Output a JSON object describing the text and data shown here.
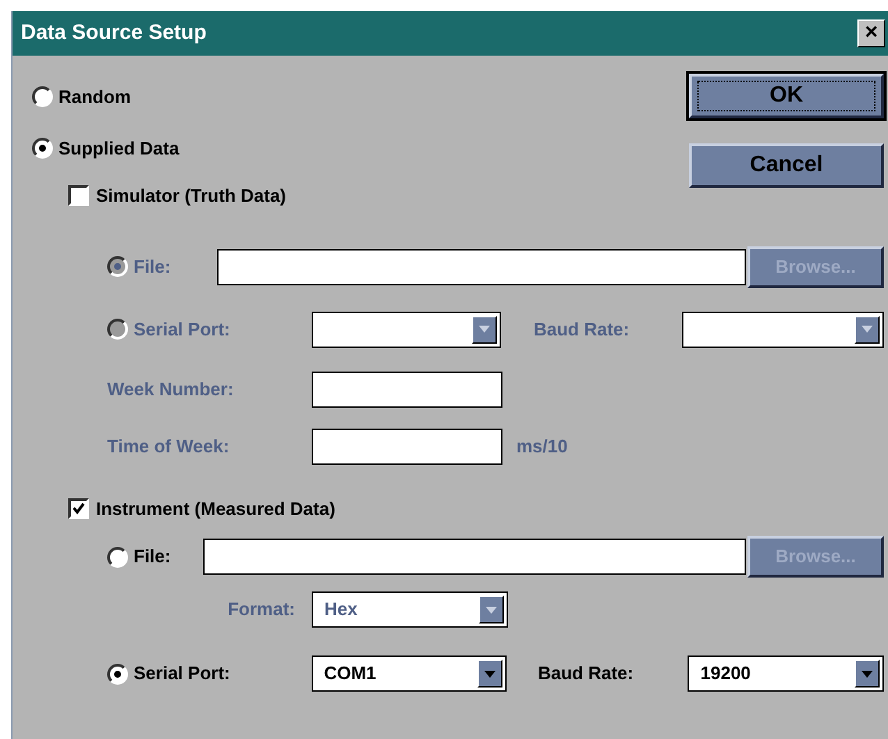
{
  "window": {
    "title": "Data Source Setup",
    "close": "×"
  },
  "source_options": [
    {
      "label": "Random",
      "selected": false
    },
    {
      "label": "Supplied Data",
      "selected": true
    }
  ],
  "buttons": [
    {
      "label": "OK",
      "default": true
    },
    {
      "label": "Cancel",
      "default": false
    }
  ],
  "simulator": {
    "label": "Simulator (Truth Data)",
    "checked": false,
    "file": {
      "label": "File:",
      "selected": true,
      "disabled": true
    },
    "browse": {
      "label": "Browse...",
      "disabled": true
    },
    "serial": {
      "label": "Serial Port:",
      "selected": false,
      "disabled": true
    },
    "baud_rate": {
      "label": "Baud Rate:",
      "disabled": true
    },
    "week_number": {
      "label": "Week Number:",
      "disabled": true
    },
    "time_of_week": {
      "label": "Time of Week:",
      "unit": "ms/10",
      "disabled": true
    }
  },
  "instrument": {
    "label": "Instrument (Measured Data)",
    "checked": true,
    "file": {
      "label": "File:",
      "selected": false,
      "disabled": false
    },
    "browse": {
      "label": "Browse...",
      "disabled": true
    },
    "format": {
      "label": "Format:",
      "value": "Hex",
      "disabled": true
    },
    "serial": {
      "label": "Serial Port:",
      "selected": true,
      "disabled": false,
      "value": "COM1"
    },
    "baud_rate": {
      "label": "Baud Rate:",
      "value": "19200",
      "disabled": false
    }
  }
}
